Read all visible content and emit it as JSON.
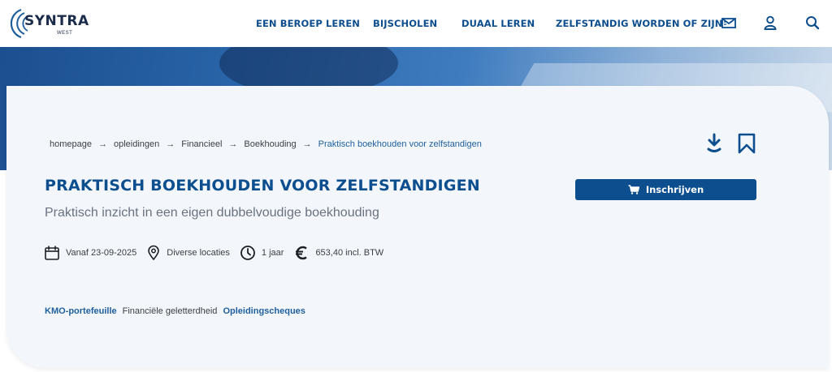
{
  "header": {
    "logo": {
      "name": "SYNTRA",
      "sub": "WEST"
    },
    "nav": [
      {
        "label": "EEN BEROEP LEREN"
      },
      {
        "label": "BIJSCHOLEN"
      },
      {
        "label": "DUAAL LEREN"
      },
      {
        "label": "ZELFSTANDIG WORDEN OF ZIJN"
      }
    ],
    "icons": [
      "mail-icon",
      "user-icon",
      "search-icon"
    ]
  },
  "breadcrumb": [
    {
      "label": "homepage"
    },
    {
      "label": "opleidingen"
    },
    {
      "label": "Financieel"
    },
    {
      "label": "Boekhouding"
    },
    {
      "label": "Praktisch boekhouden voor zelfstandigen"
    }
  ],
  "course": {
    "title": "PRAKTISCH BOEKHOUDEN VOOR ZELFSTANDIGEN",
    "subtitle": "Praktisch inzicht in een eigen dubbelvoudige boekhouding",
    "meta": {
      "start": "Vanaf 23-09-2025",
      "location": "Diverse locaties",
      "duration": "1 jaar",
      "price": "653,40 incl. BTW"
    },
    "tags": [
      {
        "label": "KMO-portefeuille"
      },
      {
        "label": "Financiële geletterdheid"
      },
      {
        "label": "Opleidingscheques"
      }
    ],
    "enroll_label": "Inschrijven"
  },
  "colors": {
    "primary": "#0c4e8e",
    "link": "#1f5f9e",
    "card_bg": "#f3f7fb",
    "text": "#3a3f47",
    "muted": "#6a7280"
  }
}
